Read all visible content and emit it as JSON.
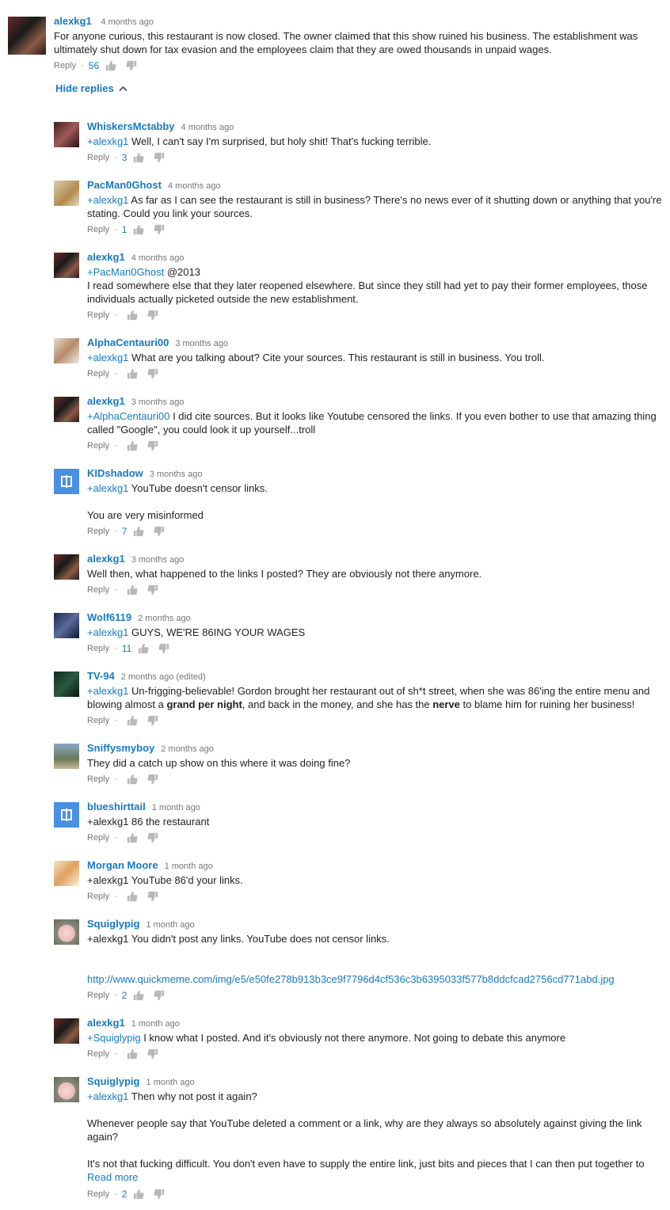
{
  "top": {
    "author": "alexkg1",
    "time": "4 months ago",
    "text": "For anyone curious,  this restaurant is now closed. The owner claimed that this show ruined his business. The establishment was ultimately shut down for tax evasion and the employees claim that they are owed thousands in unpaid wages.",
    "reply_label": "Reply",
    "likes": "56"
  },
  "hide_replies_label": "Hide replies",
  "replies": [
    {
      "author": "WhiskersMctabby",
      "time": "4 months ago",
      "mention": "+alexkg1",
      "text": " Well, I can't say I'm surprised, but holy shit! That's fucking terrible.",
      "reply_label": "Reply",
      "likes": "3"
    },
    {
      "author": "PacMan0Ghost",
      "time": "4 months ago",
      "mention": "+alexkg1",
      "text": " As far as I can see the restaurant is still in business? There's no news ever of it shutting down or anything that you're stating. Could you link your sources.",
      "reply_label": "Reply",
      "likes": "1"
    },
    {
      "author": "alexkg1",
      "time": "4 months ago",
      "mention": "+PacMan0Ghost",
      "text": " @2013",
      "text2": "I read somewhere else that they later reopened elsewhere. But since they still had yet to pay their former employees, those individuals actually picketed outside the new establishment.",
      "reply_label": "Reply",
      "likes": ""
    },
    {
      "author": "AlphaCentauri00",
      "time": "3 months ago",
      "mention": "+alexkg1",
      "text": " What are you talking about? Cite your sources. This restaurant is still in business. You troll.",
      "reply_label": "Reply",
      "likes": ""
    },
    {
      "author": "alexkg1",
      "time": "3 months ago",
      "mention": "+AlphaCentauri00",
      "text": " I did cite sources. But it looks like Youtube censored the links. If you even bother to use that amazing thing called \"Google\", you could look it up yourself...troll",
      "reply_label": "Reply",
      "likes": ""
    },
    {
      "author": "KIDshadow",
      "time": "3 months ago",
      "mention": "+alexkg1",
      "text": " YouTube doesn't censor links.",
      "text2": "You are very misinformed",
      "reply_label": "Reply",
      "likes": "7"
    },
    {
      "author": "alexkg1",
      "time": "3 months ago",
      "text": "Well then, what happened to the links I posted? They are obviously not there anymore.",
      "reply_label": "Reply",
      "likes": ""
    },
    {
      "author": "Wolf6119",
      "time": "2 months ago",
      "mention": "+alexkg1",
      "text": " GUYS, WE'RE 86ING YOUR WAGES",
      "reply_label": "Reply",
      "likes": "11"
    },
    {
      "author": "TV-94",
      "time": "2 months ago (edited)",
      "mention": "+alexkg1",
      "text_a": " Un-frigging-believable! Gordon brought her restaurant out of sh*t street, when she was 86'ing the entire menu and blowing almost a ",
      "bold_a": "grand per night",
      "text_b": ", and back in the money, and she has the ",
      "bold_b": "nerve",
      "text_c": " to blame him for ruining her business!",
      "reply_label": "Reply",
      "likes": ""
    },
    {
      "author": "Sniffysmyboy",
      "time": "2 months ago",
      "text": "They did a catch up show on this where it was doing fine?",
      "reply_label": "Reply",
      "likes": ""
    },
    {
      "author": "blueshirttail",
      "time": "1 month ago",
      "text": "+alexkg1 86 the restaurant",
      "reply_label": "Reply",
      "likes": ""
    },
    {
      "author": "Morgan Moore",
      "time": "1 month ago",
      "text": "+alexkg1 YouTube 86'd your links.",
      "reply_label": "Reply",
      "likes": ""
    },
    {
      "author": "Squiglypig",
      "time": "1 month ago",
      "text": "+alexkg1 You didn't post any links. YouTube does not censor links.",
      "link": "http://www.quickmeme.com/img/e5/e50fe278b913b3ce9f7796d4cf536c3b6395033f577b8ddcfcad2756cd771abd.jpg",
      "reply_label": "Reply",
      "likes": "2"
    },
    {
      "author": "alexkg1",
      "time": "1 month ago",
      "mention": "+Squiglypig",
      "text": " I know what I posted. And it's obviously not there anymore. Not going to debate this anymore",
      "reply_label": "Reply",
      "likes": ""
    },
    {
      "author": "Squiglypig",
      "time": "1 month ago",
      "mention": "+alexkg1",
      "text": " Then why not post it again?",
      "text2": "Whenever people say that YouTube deleted a comment or a link, why are they always so absolutely against giving the link again?",
      "text3": "It's not that fucking difficult. You don't even have to supply the entire link, just bits and pieces that I can then put together to",
      "read_more": "Read more",
      "reply_label": "Reply",
      "likes": "2"
    }
  ]
}
